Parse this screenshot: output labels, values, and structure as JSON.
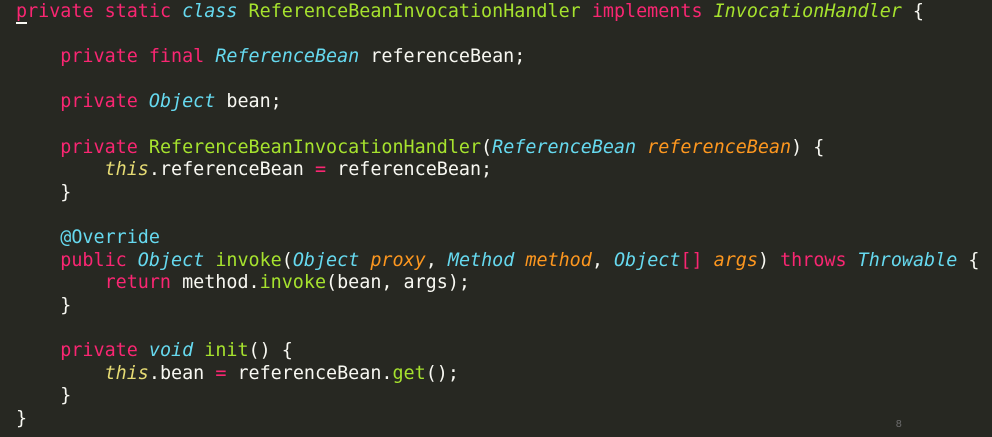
{
  "code": {
    "lines": [
      [
        {
          "t": "p",
          "c": "kw first-p"
        },
        {
          "t": "rivate static ",
          "c": "kw"
        },
        {
          "t": "class",
          "c": "typ"
        },
        {
          "t": " ",
          "c": "txt"
        },
        {
          "t": "ReferenceBeanInvocationHandler",
          "c": "fn"
        },
        {
          "t": " ",
          "c": "txt"
        },
        {
          "t": "implements",
          "c": "kw"
        },
        {
          "t": " ",
          "c": "txt"
        },
        {
          "t": "InvocationHandler",
          "c": "ith"
        },
        {
          "t": " {",
          "c": "txt"
        }
      ],
      [],
      [
        {
          "t": "    private final ",
          "c": "kw"
        },
        {
          "t": "ReferenceBean",
          "c": "typ"
        },
        {
          "t": " referenceBean;",
          "c": "txt"
        }
      ],
      [],
      [
        {
          "t": "    private ",
          "c": "kw"
        },
        {
          "t": "Object",
          "c": "typ"
        },
        {
          "t": " bean;",
          "c": "txt"
        }
      ],
      [],
      [
        {
          "t": "    private ",
          "c": "kw"
        },
        {
          "t": "ReferenceBeanInvocationHandler",
          "c": "fn"
        },
        {
          "t": "(",
          "c": "txt"
        },
        {
          "t": "ReferenceBean",
          "c": "typ"
        },
        {
          "t": " ",
          "c": "txt"
        },
        {
          "t": "referenceBean",
          "c": "par"
        },
        {
          "t": ") {",
          "c": "txt"
        }
      ],
      [
        {
          "t": "        ",
          "c": "txt"
        },
        {
          "t": "this",
          "c": "ths"
        },
        {
          "t": ".referenceBean ",
          "c": "txt"
        },
        {
          "t": "=",
          "c": "kw"
        },
        {
          "t": " referenceBean;",
          "c": "txt"
        }
      ],
      [
        {
          "t": "    }",
          "c": "txt"
        }
      ],
      [],
      [
        {
          "t": "    @Override",
          "c": "ann"
        }
      ],
      [
        {
          "t": "    public ",
          "c": "kw"
        },
        {
          "t": "Object",
          "c": "typ"
        },
        {
          "t": " ",
          "c": "txt"
        },
        {
          "t": "invoke",
          "c": "fn"
        },
        {
          "t": "(",
          "c": "txt"
        },
        {
          "t": "Object",
          "c": "typ"
        },
        {
          "t": " ",
          "c": "txt"
        },
        {
          "t": "proxy",
          "c": "par"
        },
        {
          "t": ", ",
          "c": "txt"
        },
        {
          "t": "Method",
          "c": "typ"
        },
        {
          "t": " ",
          "c": "txt"
        },
        {
          "t": "method",
          "c": "par"
        },
        {
          "t": ", ",
          "c": "txt"
        },
        {
          "t": "Object",
          "c": "typ"
        },
        {
          "t": "[]",
          "c": "kw"
        },
        {
          "t": " ",
          "c": "txt"
        },
        {
          "t": "args",
          "c": "par"
        },
        {
          "t": ") ",
          "c": "txt"
        },
        {
          "t": "throws",
          "c": "kw"
        },
        {
          "t": " ",
          "c": "txt"
        },
        {
          "t": "Throwable",
          "c": "typ"
        },
        {
          "t": " {",
          "c": "txt"
        }
      ],
      [
        {
          "t": "        return",
          "c": "kw"
        },
        {
          "t": " method.",
          "c": "txt"
        },
        {
          "t": "invoke",
          "c": "fn"
        },
        {
          "t": "(bean, args);",
          "c": "txt"
        }
      ],
      [
        {
          "t": "    }",
          "c": "txt"
        }
      ],
      [],
      [
        {
          "t": "    private ",
          "c": "kw"
        },
        {
          "t": "void",
          "c": "typ"
        },
        {
          "t": " ",
          "c": "txt"
        },
        {
          "t": "init",
          "c": "fn"
        },
        {
          "t": "() {",
          "c": "txt"
        }
      ],
      [
        {
          "t": "        ",
          "c": "txt"
        },
        {
          "t": "this",
          "c": "ths"
        },
        {
          "t": ".bean ",
          "c": "txt"
        },
        {
          "t": "=",
          "c": "kw"
        },
        {
          "t": " referenceBean.",
          "c": "txt"
        },
        {
          "t": "get",
          "c": "fn"
        },
        {
          "t": "();",
          "c": "txt"
        }
      ],
      [
        {
          "t": "    }",
          "c": "txt"
        }
      ],
      [
        {
          "t": "}",
          "c": "txt"
        }
      ]
    ]
  },
  "page_number": "8"
}
